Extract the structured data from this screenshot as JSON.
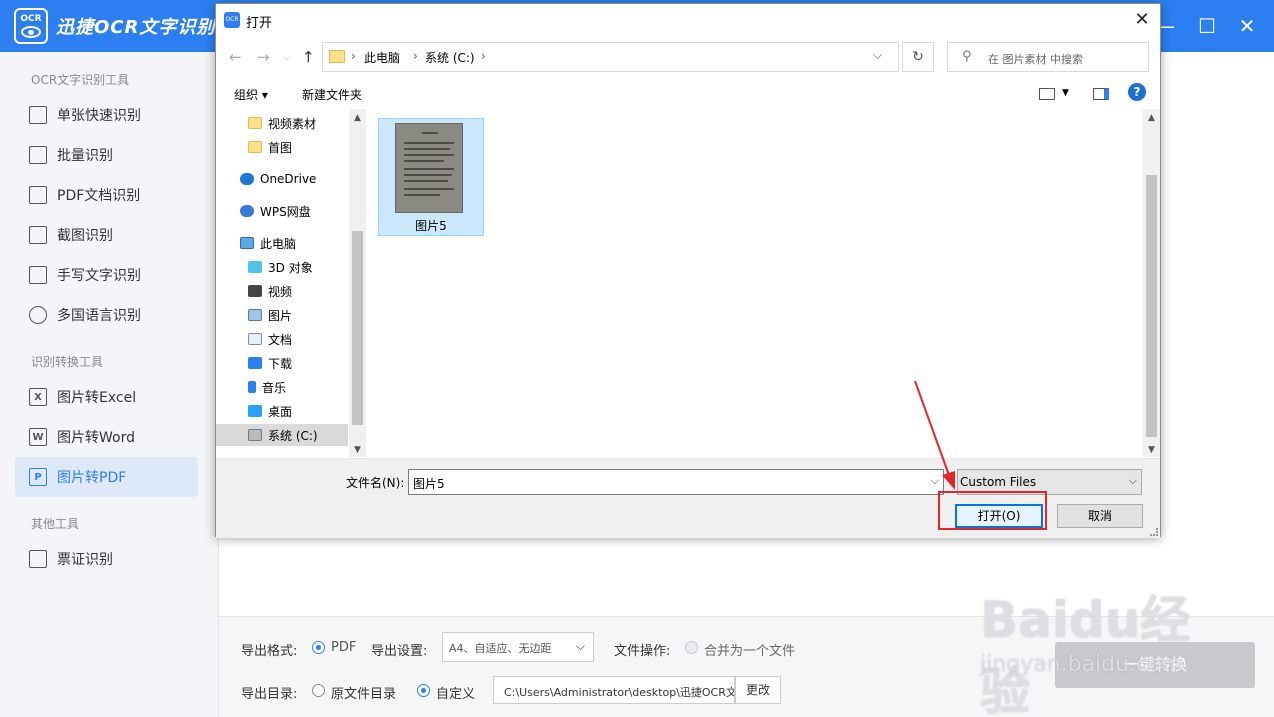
{
  "app": {
    "title": "迅捷OCR文字识别",
    "logo_text": "OCR",
    "window_buttons": [
      "minimize",
      "maximize",
      "close"
    ]
  },
  "sidebar": {
    "section1": "OCR文字识别工具",
    "section2": "识别转换工具",
    "section3": "其他工具",
    "items": [
      {
        "label": "单张快速识别",
        "icon": "image-scan-icon"
      },
      {
        "label": "批量识别",
        "icon": "stack-icon"
      },
      {
        "label": "PDF文档识别",
        "icon": "pdf-icon"
      },
      {
        "label": "截图识别",
        "icon": "crop-icon"
      },
      {
        "label": "手写文字识别",
        "icon": "pen-icon"
      },
      {
        "label": "多国语言识别",
        "icon": "globe-icon"
      },
      {
        "label": "图片转Excel",
        "icon": "excel-icon",
        "glyph": "X"
      },
      {
        "label": "图片转Word",
        "icon": "word-icon",
        "glyph": "W"
      },
      {
        "label": "图片转PDF",
        "icon": "pdf-p-icon",
        "glyph": "P",
        "active": true
      },
      {
        "label": "票证识别",
        "icon": "card-icon"
      }
    ]
  },
  "bottom": {
    "format_label": "导出格式:",
    "format_value": "PDF",
    "settings_label": "导出设置:",
    "settings_value": "A4、自适应、无边距",
    "file_op_label": "文件操作:",
    "file_op_value": "合并为一个文件",
    "dir_label": "导出目录:",
    "dir_original": "原文件目录",
    "dir_custom": "自定义",
    "dir_path": "C:\\Users\\Administrator\\desktop\\迅捷OCR文",
    "change_btn": "更改",
    "convert_btn": "一键转换"
  },
  "dialog": {
    "title": "打开",
    "breadcrumb": [
      "此电脑",
      "系统 (C:)"
    ],
    "search_placeholder": "在 图片素材 中搜索",
    "organize": "组织 ▾",
    "new_folder": "新建文件夹",
    "nav_items": [
      {
        "label": "视频素材",
        "icon": "folder-icon"
      },
      {
        "label": "首图",
        "icon": "folder-icon"
      },
      {
        "label": "OneDrive",
        "icon": "cloud-icon"
      },
      {
        "label": "WPS网盘",
        "icon": "wps-cloud-icon"
      },
      {
        "label": "此电脑",
        "icon": "computer-icon"
      },
      {
        "label": "3D 对象",
        "icon": "cube-icon"
      },
      {
        "label": "视频",
        "icon": "film-icon"
      },
      {
        "label": "图片",
        "icon": "picture-icon"
      },
      {
        "label": "文档",
        "icon": "document-icon"
      },
      {
        "label": "下载",
        "icon": "download-icon"
      },
      {
        "label": "音乐",
        "icon": "music-icon"
      },
      {
        "label": "桌面",
        "icon": "desktop-icon"
      },
      {
        "label": "系统 (C:)",
        "icon": "drive-icon",
        "selected": true
      }
    ],
    "file": {
      "name": "图片5"
    },
    "filename_label": "文件名(N):",
    "filename_value": "图片5",
    "filter_value": "Custom Files",
    "open_btn": "打开(O)",
    "cancel_btn": "取消"
  },
  "watermark": {
    "big": "Baidu经验",
    "small": "jingyan.baidu.com"
  },
  "colors": {
    "accent": "#2b7ff1",
    "highlight": "#e4262c"
  }
}
